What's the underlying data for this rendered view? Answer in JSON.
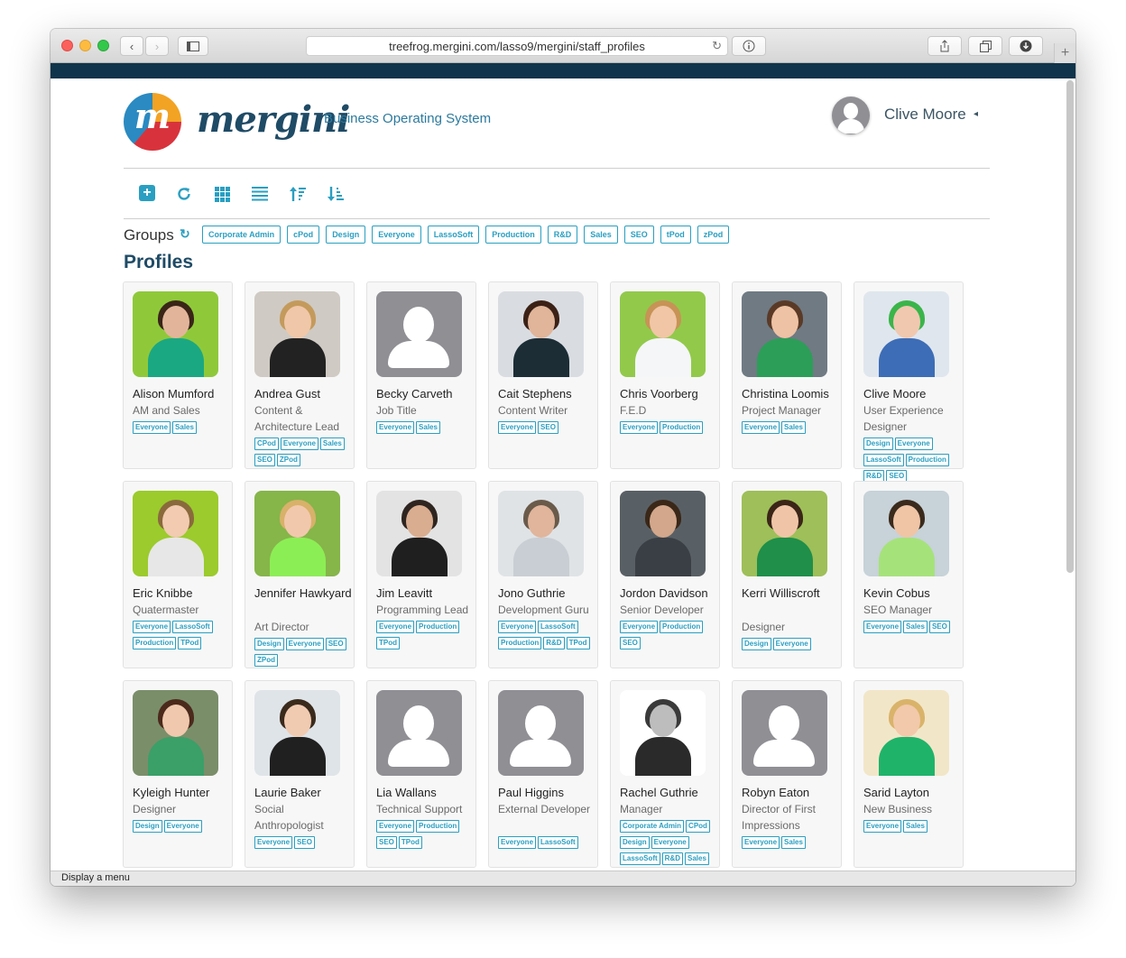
{
  "browser": {
    "url": "treefrog.mergini.com/lasso9/mergini/staff_profiles",
    "status_text": "Display a menu",
    "icons": [
      "back-icon",
      "forward-icon",
      "sidebar-icon",
      "reload-icon",
      "info-icon",
      "share-icon",
      "tabs-icon",
      "download-icon",
      "new-tab-icon"
    ]
  },
  "header": {
    "logo_letter": "m",
    "brand": "mergini",
    "tagline": "Business Operating System",
    "user_name": "Clive Moore",
    "user_caret": "◂"
  },
  "toolbar": {
    "icons": [
      "add-icon",
      "refresh-icon",
      "grid-view-icon",
      "list-view-icon",
      "sort-ascending-icon",
      "sort-descending-icon"
    ]
  },
  "groups": {
    "label": "Groups",
    "refresh_icon": "↻",
    "items": [
      "Corporate Admin",
      "cPod",
      "Design",
      "Everyone",
      "LassoSoft",
      "Production",
      "R&D",
      "Sales",
      "SEO",
      "tPod",
      "zPod"
    ]
  },
  "profiles_heading": "Profiles",
  "profiles": [
    {
      "name": "Alison Mumford",
      "title": "AM and Sales",
      "tags": [
        "Everyone",
        "Sales"
      ],
      "has_photo": true
    },
    {
      "name": "Andrea Gust",
      "title": "Content & Architecture Lead",
      "tags": [
        "CPod",
        "Everyone",
        "Sales",
        "SEO",
        "ZPod"
      ],
      "has_photo": true
    },
    {
      "name": "Becky Carveth",
      "title": "Job Title",
      "tags": [
        "Everyone",
        "Sales"
      ],
      "has_photo": false
    },
    {
      "name": "Cait Stephens",
      "title": "Content Writer",
      "tags": [
        "Everyone",
        "SEO"
      ],
      "has_photo": true
    },
    {
      "name": "Chris Voorberg",
      "title": "F.E.D",
      "tags": [
        "Everyone",
        "Production"
      ],
      "has_photo": true
    },
    {
      "name": "Christina Loomis",
      "title": "Project Manager",
      "tags": [
        "Everyone",
        "Sales"
      ],
      "has_photo": true
    },
    {
      "name": "Clive Moore",
      "title": "User Experience Designer",
      "tags": [
        "Design",
        "Everyone",
        "LassoSoft",
        "Production",
        "R&D",
        "SEO"
      ],
      "has_photo": true
    },
    {
      "name": "Eric Knibbe",
      "title": "Quatermaster",
      "tags": [
        "Everyone",
        "LassoSoft",
        "Production",
        "TPod"
      ],
      "has_photo": true
    },
    {
      "name": "Jennifer Hawkyard",
      "title": "Art Director",
      "tags": [
        "Design",
        "Everyone",
        "SEO",
        "ZPod"
      ],
      "has_photo": true
    },
    {
      "name": "Jim Leavitt",
      "title": "Programming Lead",
      "tags": [
        "Everyone",
        "Production",
        "TPod"
      ],
      "has_photo": true
    },
    {
      "name": "Jono Guthrie",
      "title": "Development Guru",
      "tags": [
        "Everyone",
        "LassoSoft",
        "Production",
        "R&D",
        "TPod"
      ],
      "has_photo": true
    },
    {
      "name": "Jordon Davidson",
      "title": "Senior Developer",
      "tags": [
        "Everyone",
        "Production",
        "SEO"
      ],
      "has_photo": true
    },
    {
      "name": "Kerri Williscroft",
      "title": "Designer",
      "tags": [
        "Design",
        "Everyone"
      ],
      "has_photo": true
    },
    {
      "name": "Kevin Cobus",
      "title": "SEO Manager",
      "tags": [
        "Everyone",
        "Sales",
        "SEO"
      ],
      "has_photo": true
    },
    {
      "name": "Kyleigh Hunter",
      "title": "Designer",
      "tags": [
        "Design",
        "Everyone"
      ],
      "has_photo": true
    },
    {
      "name": "Laurie Baker",
      "title": "Social Anthropologist",
      "tags": [
        "Everyone",
        "SEO"
      ],
      "has_photo": true
    },
    {
      "name": "Lia Wallans",
      "title": "Technical Support",
      "tags": [
        "Everyone",
        "Production",
        "SEO",
        "TPod"
      ],
      "has_photo": false
    },
    {
      "name": "Paul Higgins",
      "title": "External Developer",
      "tags": [
        "Everyone",
        "LassoSoft"
      ],
      "has_photo": false
    },
    {
      "name": "Rachel Guthrie",
      "title": "Manager",
      "tags": [
        "Corporate Admin",
        "CPod",
        "Design",
        "Everyone",
        "LassoSoft",
        "R&D",
        "Sales"
      ],
      "has_photo": true
    },
    {
      "name": "Robyn Eaton",
      "title": "Director of First Impressions",
      "tags": [
        "Everyone",
        "Sales"
      ],
      "has_photo": false
    },
    {
      "name": "Sarid Layton",
      "title": "New Business",
      "tags": [
        "Everyone",
        "Sales"
      ],
      "has_photo": true
    }
  ],
  "colors": {
    "accent": "#2a9fc1",
    "brand_navy": "#1f4b66",
    "header_strip": "#10344b",
    "placeholder_avatar": "#8f8f94"
  }
}
